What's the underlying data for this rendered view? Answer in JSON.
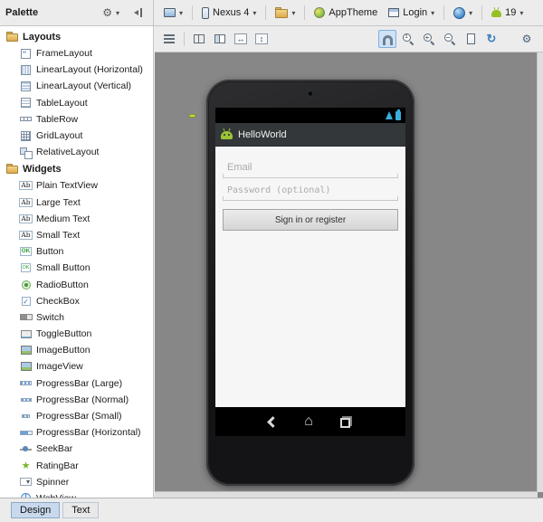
{
  "palette": {
    "title": "Palette",
    "sections": [
      {
        "label": "Layouts",
        "items": [
          {
            "label": "FrameLayout",
            "icon": "framelayout"
          },
          {
            "label": "LinearLayout (Horizontal)",
            "icon": "linearlayout-h"
          },
          {
            "label": "LinearLayout (Vertical)",
            "icon": "linearlayout-v"
          },
          {
            "label": "TableLayout",
            "icon": "tablelayout"
          },
          {
            "label": "TableRow",
            "icon": "tablerow"
          },
          {
            "label": "GridLayout",
            "icon": "gridlayout"
          },
          {
            "label": "RelativeLayout",
            "icon": "relativelayout"
          }
        ]
      },
      {
        "label": "Widgets",
        "items": [
          {
            "label": "Plain TextView",
            "icon": "textview",
            "icon_text": "Ab"
          },
          {
            "label": "Large Text",
            "icon": "textview",
            "icon_text": "Ab"
          },
          {
            "label": "Medium Text",
            "icon": "textview",
            "icon_text": "Ab"
          },
          {
            "label": "Small Text",
            "icon": "textview",
            "icon_text": "Ab"
          },
          {
            "label": "Button",
            "icon": "button",
            "icon_text": "OK"
          },
          {
            "label": "Small Button",
            "icon": "small-button",
            "icon_text": "OK"
          },
          {
            "label": "RadioButton",
            "icon": "radiobutton"
          },
          {
            "label": "CheckBox",
            "icon": "checkbox"
          },
          {
            "label": "Switch",
            "icon": "switch"
          },
          {
            "label": "ToggleButton",
            "icon": "togglebutton"
          },
          {
            "label": "ImageButton",
            "icon": "imagebutton"
          },
          {
            "label": "ImageView",
            "icon": "imageview"
          },
          {
            "label": "ProgressBar (Large)",
            "icon": "progressbar-large"
          },
          {
            "label": "ProgressBar (Normal)",
            "icon": "progressbar-normal"
          },
          {
            "label": "ProgressBar (Small)",
            "icon": "progressbar-small"
          },
          {
            "label": "ProgressBar (Horizontal)",
            "icon": "progressbar-horizontal"
          },
          {
            "label": "SeekBar",
            "icon": "seekbar"
          },
          {
            "label": "RatingBar",
            "icon": "ratingbar"
          },
          {
            "label": "Spinner",
            "icon": "spinner"
          },
          {
            "label": "WebView",
            "icon": "webview"
          }
        ]
      }
    ]
  },
  "toolbar": {
    "device_label": "Nexus 4",
    "theme_label": "AppTheme",
    "activity_label": "Login",
    "api_label": "19"
  },
  "preview": {
    "app_title": "HelloWorld",
    "email_placeholder": "Email",
    "password_placeholder": "Password (optional)",
    "signin_label": "Sign in or register"
  },
  "footer": {
    "tabs": [
      {
        "label": "Design",
        "active": true
      },
      {
        "label": "Text",
        "active": false
      }
    ]
  },
  "colors": {
    "status_icon_blue": "#39aede",
    "android_green": "#97c024",
    "canvas_gray": "#878787",
    "selected_tool_blue": "#cfe2f7"
  }
}
